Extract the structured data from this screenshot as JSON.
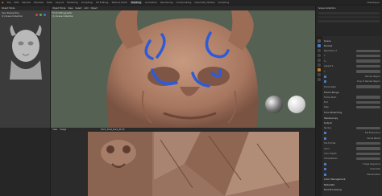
{
  "menu": {
    "items": [
      "File",
      "Edit",
      "Render",
      "Window",
      "Help"
    ],
    "tabs": [
      "Layout",
      "Modeling",
      "Sculpting",
      "UV Editing",
      "Texture Paint",
      "Shading",
      "Animation",
      "Rendering",
      "Compositing",
      "Geometry Nodes",
      "Scripting"
    ],
    "active_tab": "Shading",
    "layer": "ViewLayer"
  },
  "left_view": {
    "mode": "Object Mode",
    "title": "User Perspective",
    "collection": "(1) Scene Collection"
  },
  "main_view": {
    "mode": "Object Mode",
    "menus": [
      "View",
      "Select",
      "Add",
      "Object"
    ],
    "title": "Front Orthographic",
    "collection": "(1) Scene Collection"
  },
  "image_editor": {
    "menus": [
      "View",
      "Image"
    ],
    "image_name": "Rock_Dust_Dark_4K.tif"
  },
  "outliner": {
    "title": "Scene Collection"
  },
  "properties": {
    "scene_label": "Scene",
    "rows": [
      {
        "label": "Format",
        "type": "section"
      },
      {
        "label": "Resolution X",
        "type": "field"
      },
      {
        "label": "Y",
        "type": "field"
      },
      {
        "label": "%",
        "type": "field"
      },
      {
        "label": "Aspect X",
        "type": "field"
      },
      {
        "label": "Y",
        "type": "field"
      },
      {
        "label": "Render Region",
        "type": "check"
      },
      {
        "label": "Crop to Render Region",
        "type": "check"
      },
      {
        "label": "Frame Rate",
        "type": "field"
      },
      {
        "label": "Frame Range",
        "type": "section"
      },
      {
        "label": "Frame Start",
        "type": "field"
      },
      {
        "label": "End",
        "type": "field"
      },
      {
        "label": "Step",
        "type": "field"
      },
      {
        "label": "Time Stretching",
        "type": "section"
      },
      {
        "label": "Stereoscopy",
        "type": "section"
      },
      {
        "label": "Output",
        "type": "section"
      },
      {
        "label": "Saving",
        "type": "field"
      },
      {
        "label": "File Extensions",
        "type": "check"
      },
      {
        "label": "Cache Result",
        "type": "check"
      },
      {
        "label": "File Format",
        "type": "field"
      },
      {
        "label": "Color",
        "type": "field"
      },
      {
        "label": "Color Depth",
        "type": "field"
      },
      {
        "label": "Compression",
        "type": "field"
      },
      {
        "label": "Image Sequence",
        "type": "check"
      },
      {
        "label": "Overwrite",
        "type": "check"
      },
      {
        "label": "Placeholders",
        "type": "check"
      },
      {
        "label": "Color Management",
        "type": "section"
      },
      {
        "label": "Metadata",
        "type": "section"
      },
      {
        "label": "Post Processing",
        "type": "section"
      }
    ]
  },
  "colors": {
    "annotation_stroke": "#2f5bd8",
    "viewport_bg": "#556153",
    "accent": "#4a7dc9"
  }
}
